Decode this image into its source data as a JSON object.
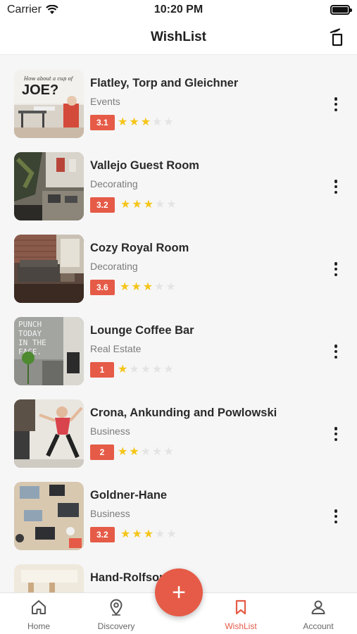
{
  "status_bar": {
    "carrier": "Carrier",
    "time": "10:20 PM"
  },
  "header": {
    "title": "WishList"
  },
  "items": [
    {
      "name": "Flatley, Torp and Gleichner",
      "category": "Events",
      "rating": "3.1",
      "stars": 3
    },
    {
      "name": "Vallejo Guest Room",
      "category": "Decorating",
      "rating": "3.2",
      "stars": 3
    },
    {
      "name": "Cozy Royal Room",
      "category": "Decorating",
      "rating": "3.6",
      "stars": 3
    },
    {
      "name": "Lounge Coffee Bar",
      "category": "Real Estate",
      "rating": "1",
      "stars": 1
    },
    {
      "name": "Crona, Ankunding and Powlowski",
      "category": "Business",
      "rating": "2",
      "stars": 2
    },
    {
      "name": "Goldner-Hane",
      "category": "Business",
      "rating": "3.2",
      "stars": 3
    },
    {
      "name": "Hand-Rolfson",
      "category": "",
      "rating": "",
      "stars": 0
    }
  ],
  "thumb_text": {
    "joe_line1": "How about a cup of",
    "joe_line2": "JOE?",
    "punch": [
      "PUNCH",
      "TODAY",
      "IN THE",
      "FACE."
    ]
  },
  "tabs": [
    {
      "label": "Home",
      "icon": "home-icon"
    },
    {
      "label": "Discovery",
      "icon": "location-pin-icon"
    },
    {
      "label": "WishList",
      "icon": "bookmark-icon"
    },
    {
      "label": "Account",
      "icon": "person-icon"
    }
  ],
  "fab": {
    "label": "+"
  },
  "colors": {
    "accent": "#e55b47",
    "star": "#f5c518"
  }
}
